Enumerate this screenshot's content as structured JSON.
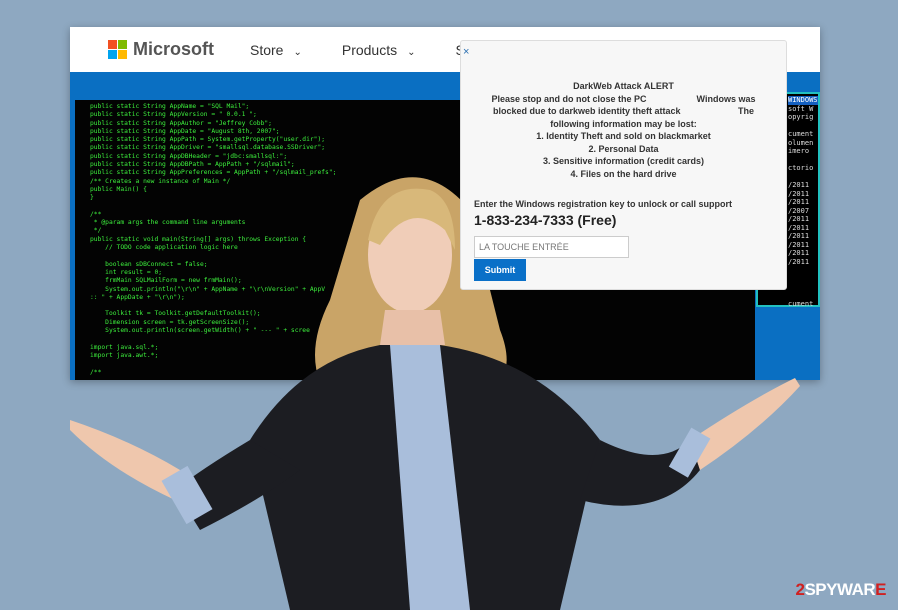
{
  "site": {
    "brand": "Microsoft",
    "nav": [
      {
        "label": "Store"
      },
      {
        "label": "Products"
      },
      {
        "label": "Su"
      }
    ],
    "logo_colors": [
      "#f25022",
      "#7fba00",
      "#00a4ef",
      "#ffb900"
    ]
  },
  "code_lines": "public static String AppName = \"SQL Mail\";\npublic static String AppVersion = \" 0.0.1 \";\npublic static String AppAuthor = \"Jeffrey Cobb\";\npublic static String AppDate = \"August 8th, 2007\";\npublic static String AppPath = System.getProperty(\"user.dir\");\npublic static String AppDriver = \"smallsql.database.SSDriver\";\npublic static String AppDBHeader = \"jdbc:smallsql:\";\npublic static String AppDBPath = AppPath + \"/sqlmail\";\npublic static String AppPreferences = AppPath + \"/sqlmail_prefs\";\n/** Creates a new instance of Main */\npublic Main() {\n}\n\n/**\n * @param args the command line arguments\n */\npublic static void main(String[] args) throws Exception {\n    // TODO code application logic here\n\n    boolean sDBConnect = false;\n    int result = 0;\n    frmMain SQLMailForm = new frmMain();\n    System.out.println(\"\\r\\n\" + AppName + \"\\r\\nVersion\" + AppV\n:: \" + AppDate + \"\\r\\n\");\n\n    Toolkit tk = Toolkit.getDefaultToolkit();\n    Dimension screen = tk.getScreenSize();\n    System.out.println(screen.getWidth() + \" --- \" + scree\n\nimport java.sql.*;\nimport java.awt.*;\n\n/**",
  "cmd": {
    "title": "WINDOWS",
    "lines": "soft W\nopyrig\n\ncument\nolumen\nimero\n\nctorio\n\n/2011\n/2011\n/2011\n/2007\n/2011\n/2011\n/2011\n/2011\n/2011\n/2011\n\n\n\n\ncument"
  },
  "popup": {
    "close": "×",
    "title": "DarkWeb Attack ALERT",
    "line1": "Please stop and do not close the PC                    Windows was",
    "line2": "blocked due to darkweb identity theft attack                       The",
    "line3": "following information may be lost:",
    "items": [
      "1. Identity  Theft and sold on blackmarket",
      "2. Personal Data",
      "3. Sensitive information (credit cards)",
      "4. Files on the hard drive"
    ],
    "prompt": "Enter the Windows registration key to unlock or call support",
    "phone": "1-833-234-7333 (Free)",
    "key_value": "LA TOUCHE ENTRÉE",
    "submit": "Submit"
  },
  "watermark": {
    "prefix": "2",
    "name": "SPYWAR",
    "suffix": "E"
  }
}
